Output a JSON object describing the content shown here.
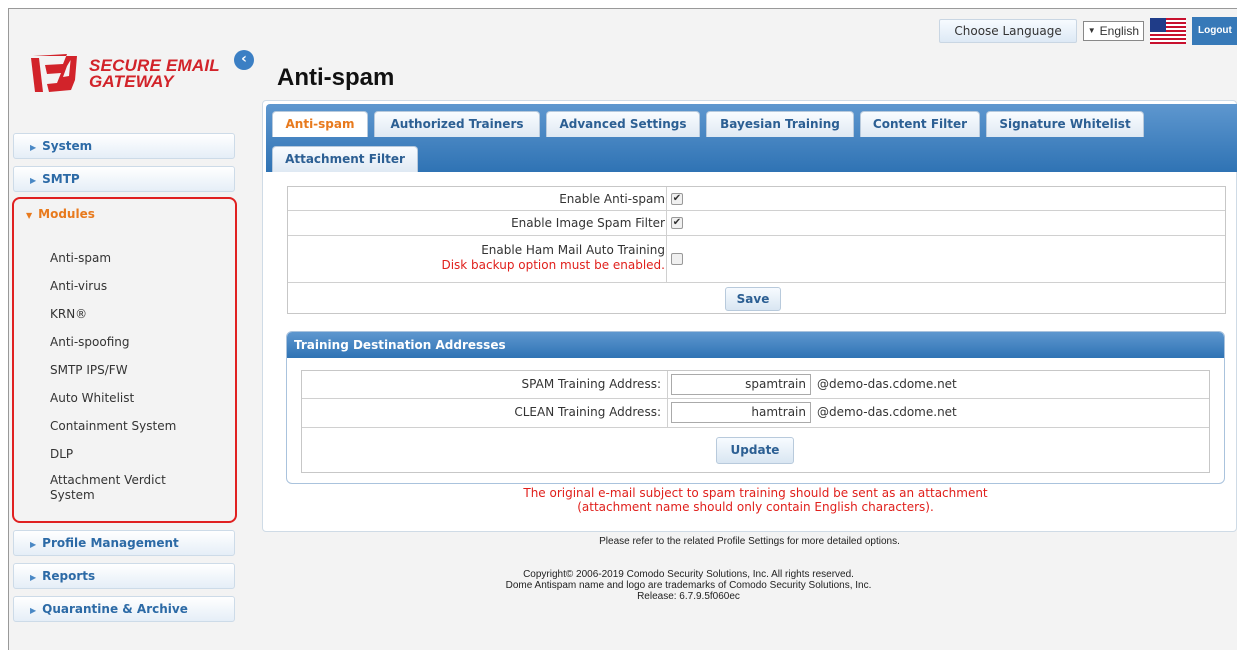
{
  "header": {
    "choose_language": "Choose Language",
    "language_value": "English",
    "logout": "Logout"
  },
  "logo": {
    "line1": "SECURE EMAIL",
    "line2": "GATEWAY"
  },
  "sidebar": {
    "system": "System",
    "smtp": "SMTP",
    "modules": {
      "label": "Modules",
      "items": [
        "Anti-spam",
        "Anti-virus",
        "KRN®",
        "Anti-spoofing",
        "SMTP IPS/FW",
        "Auto Whitelist",
        "Containment System",
        "DLP",
        "Attachment Verdict",
        "System"
      ]
    },
    "profile_management": "Profile Management",
    "reports": "Reports",
    "quarantine": "Quarantine & Archive"
  },
  "page": {
    "title": "Anti-spam"
  },
  "tabs": [
    "Anti-spam",
    "Authorized Trainers",
    "Advanced Settings",
    "Bayesian Training",
    "Content Filter",
    "Signature Whitelist",
    "Attachment Filter"
  ],
  "settings": {
    "enable_antispam": {
      "label": "Enable Anti-spam",
      "checked": true
    },
    "enable_image_spam": {
      "label": "Enable Image Spam Filter",
      "checked": true
    },
    "enable_ham": {
      "label": "Enable Ham Mail Auto Training",
      "warning": "Disk backup option must be enabled.",
      "checked": false
    },
    "save": "Save"
  },
  "training": {
    "title": "Training Destination Addresses",
    "spam_label": "SPAM Training Address:",
    "spam_value": "spamtrain",
    "spam_domain": "@demo-das.cdome.net",
    "clean_label": "CLEAN Training Address:",
    "clean_value": "hamtrain",
    "clean_domain": "@demo-das.cdome.net",
    "update": "Update"
  },
  "notice": {
    "line1": "The original e-mail subject to spam training should be sent as an attachment",
    "line2": "(attachment name should only contain English characters)."
  },
  "refer": "Please refer to the related Profile Settings for more detailed options.",
  "footer": {
    "line1": "Copyright© 2006-2019 Comodo Security Solutions, Inc. All rights reserved.",
    "line2": "Dome Antispam name and logo are trademarks of Comodo Security Solutions, Inc.",
    "line3": "Release: 6.7.9.5f060ec"
  },
  "colors": {
    "accent_blue": "#2f73b4",
    "active_orange": "#e87a1d",
    "warning_red": "#e0201c",
    "brand_red": "#d2232a"
  }
}
